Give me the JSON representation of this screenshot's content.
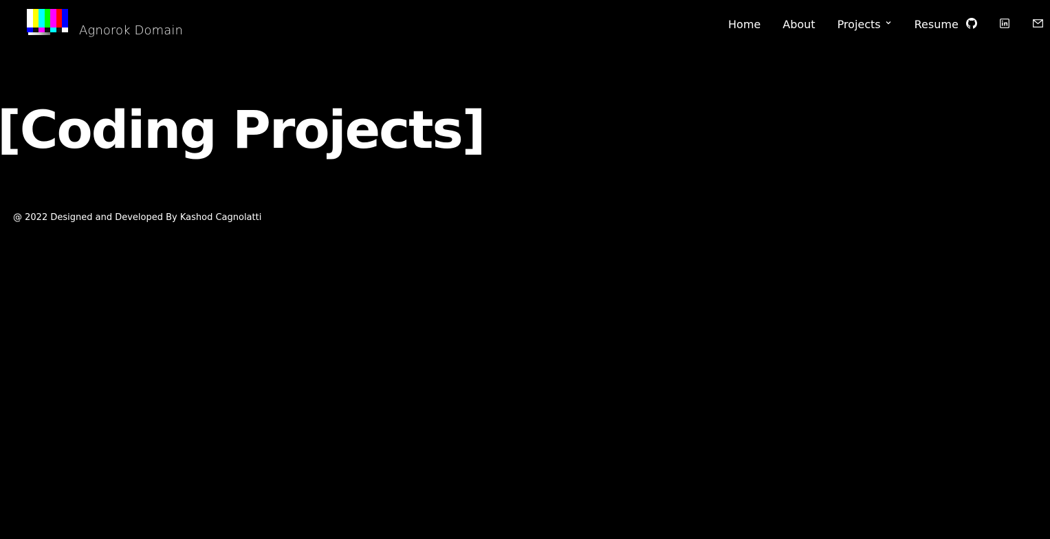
{
  "brand": {
    "name": "Agnorok Domain",
    "logo_colors": [
      "#ffffff",
      "#ffff00",
      "#00ffff",
      "#00ff00",
      "#ff00ff",
      "#ff0000",
      "#0000ff"
    ],
    "logo_bottom_colors": [
      "#0000ff",
      "#111111",
      "#ff00ff",
      "#111111",
      "#00ffff",
      "#111111",
      "#ffffff"
    ]
  },
  "nav": {
    "items": [
      {
        "label": "Home"
      },
      {
        "label": "About"
      },
      {
        "label": "Projects",
        "icon": "chevron-down-icon"
      },
      {
        "label": "Resume"
      }
    ],
    "social": [
      {
        "icon": "github-icon"
      },
      {
        "icon": "linkedin-icon"
      },
      {
        "icon": "mail-icon"
      }
    ]
  },
  "main": {
    "title": "[Coding Projects]"
  },
  "footer": {
    "text": "@ 2022 Designed and Developed By Kashod Cagnolatti"
  },
  "colors": {
    "background": "#000000",
    "text": "#ffffff"
  }
}
